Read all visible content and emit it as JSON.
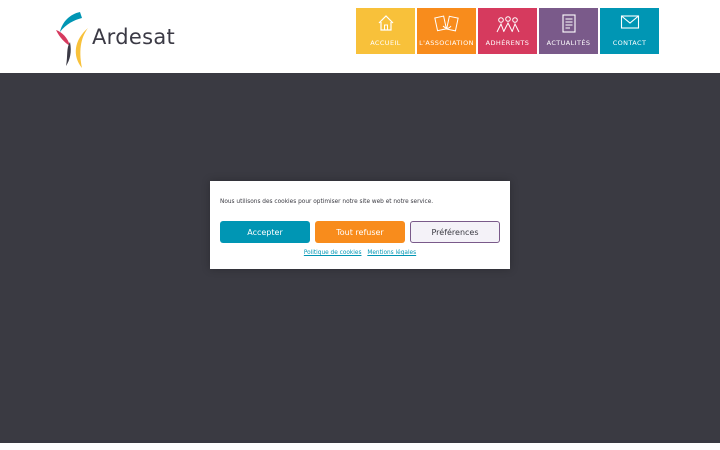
{
  "header": {
    "logo_text": "Ardesat"
  },
  "nav": {
    "items": [
      {
        "label": "ACCUEIL",
        "icon": "home-icon",
        "color": "#f8c13a"
      },
      {
        "label": "L'ASSOCIATION",
        "icon": "handshake-icon",
        "color": "#f88c1c"
      },
      {
        "label": "ADHÉRENTS",
        "icon": "people-icon",
        "color": "#d63a5e"
      },
      {
        "label": "ACTUALITÉS",
        "icon": "document-icon",
        "color": "#7a5a8a"
      },
      {
        "label": "CONTACT",
        "icon": "envelope-icon",
        "color": "#0096b4"
      }
    ]
  },
  "cookie": {
    "message": "Nous utilisons des cookies pour optimiser notre site web et notre service.",
    "accept_label": "Accepter",
    "refuse_label": "Tout refuser",
    "preferences_label": "Préférences",
    "policy_link": "Politique de cookies",
    "legal_link": "Mentions légales"
  },
  "colors": {
    "overlay": "#3a3a42",
    "accept": "#0096b4",
    "refuse": "#f88c1c"
  }
}
